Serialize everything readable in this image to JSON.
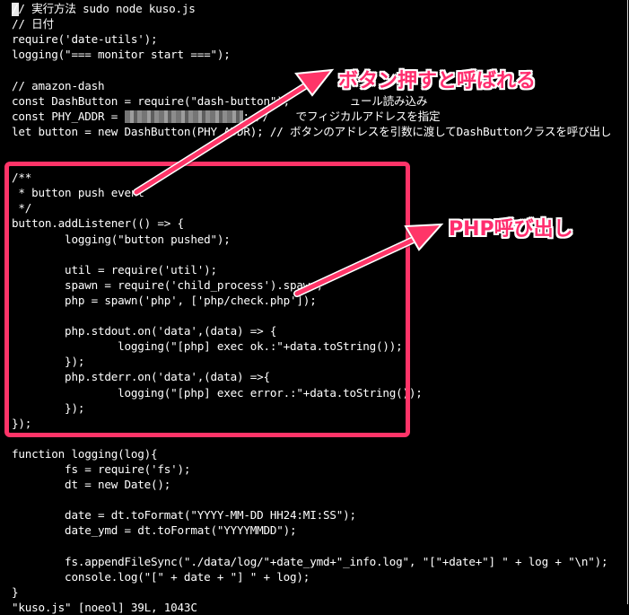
{
  "code_lines": [
    "// 実行方法 sudo node kuso.js",
    "// 日付",
    "require('date-utils');",
    "logging(\"=== monitor start ===\");",
    "",
    "// amazon-dash",
    "const DashButton = require(\"dash-button\");         ュール読み込み",
    "const PHY_ADDR = ",
    "let button = new DashButton(PHY_ADDR); // ボタンのアドレスを引数に渡してDashButtonクラスを呼び出し",
    "",
    "",
    "/**",
    " * button push event",
    " */",
    "button.addListener(() => {",
    "        logging(\"button pushed\");",
    "",
    "        util = require('util');",
    "        spawn = require('child_process').spawn;",
    "        php = spawn('php', ['php/check.php']);",
    "",
    "        php.stdout.on('data',(data) => {",
    "                logging(\"[php] exec ok.:\"+data.toString());",
    "        });",
    "        php.stderr.on('data',(data) =>{",
    "                logging(\"[php] exec error.:\"+data.toString());",
    "        });",
    "});",
    "",
    "function logging(log){",
    "        fs = require('fs');",
    "        dt = new Date();",
    "",
    "        date = dt.toFormat(\"YYYY-MM-DD HH24:MI:SS\");",
    "        date_ymd = dt.toFormat(\"YYYYMMDD\");",
    "",
    "        fs.appendFileSync(\"./data/log/\"+date_ymd+\"_info.log\", \"[\"+date+\"] \" + log + \"\\n\");",
    "        console.log(\"[\" + date + \"] \" + log);",
    "}",
    "\"kuso.js\" [noeol] 39L, 1043C"
  ],
  "phy_addr_tail": "; //    でフィジカルアドレスを指定",
  "callouts": {
    "button_press": "ボタン押すと呼ばれる",
    "php_call": "PHP呼び出し"
  },
  "colors": {
    "background": "#000000",
    "text": "#ffffff",
    "highlight": "#ff3468",
    "callout_text": "#ff2d6e"
  }
}
